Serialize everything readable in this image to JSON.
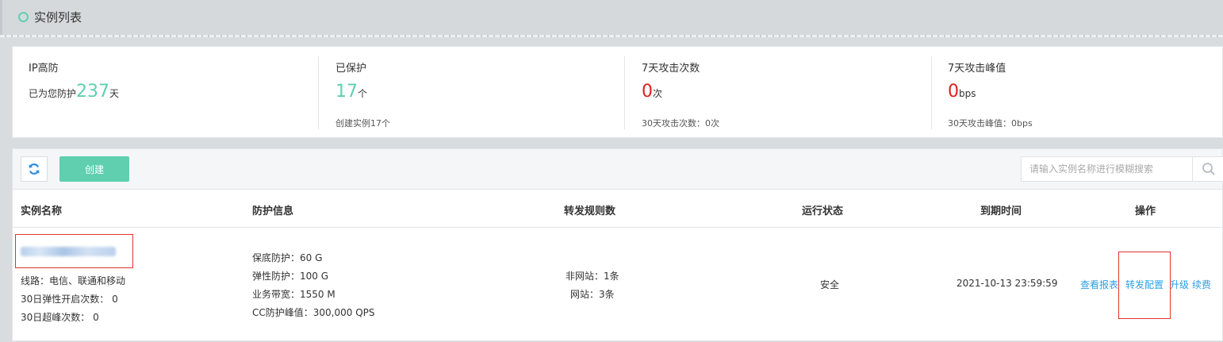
{
  "header": {
    "title": "实例列表"
  },
  "stats": [
    {
      "label": "IP高防",
      "prefix": "已为您防护",
      "value": "237",
      "unit": "天",
      "sub": ""
    },
    {
      "label": "已保护",
      "prefix": "",
      "value": "17",
      "unit": "个",
      "sub": "创建实例17个"
    },
    {
      "label": "7天攻击次数",
      "prefix": "",
      "value": "0",
      "unit": "次",
      "sub": "30天攻击次数：0次"
    },
    {
      "label": "7天攻击峰值",
      "prefix": "",
      "value": "0",
      "unit": "bps",
      "sub": "30天攻击峰值：0bps"
    }
  ],
  "toolbar": {
    "refresh_icon": "refresh-icon",
    "create_label": "创建",
    "search_placeholder": "请输入实例名称进行模糊搜索",
    "search_icon": "search-icon"
  },
  "table": {
    "headers": [
      "实例名称",
      "防护信息",
      "转发规则数",
      "运行状态",
      "到期时间",
      "操作"
    ],
    "rows": [
      {
        "name_lines": [
          "线路：电信、联通和移动",
          "30日弹性开启次数： 0",
          "30日超峰次数： 0"
        ],
        "protection": [
          "保底防护：60 G",
          "弹性防护：100 G",
          "业务带宽：1550 M",
          "CC防护峰值：300,000 QPS"
        ],
        "rules": [
          "非网站：1条",
          "网站：3条"
        ],
        "status": "安全",
        "expire": "2021-10-13 23:59:59",
        "actions": [
          "查看报表",
          "转发配置",
          "升级",
          "续费"
        ]
      }
    ]
  },
  "colors": {
    "accent": "#5fcfb0",
    "alert": "#e0201b",
    "link": "#2aa0e6"
  }
}
